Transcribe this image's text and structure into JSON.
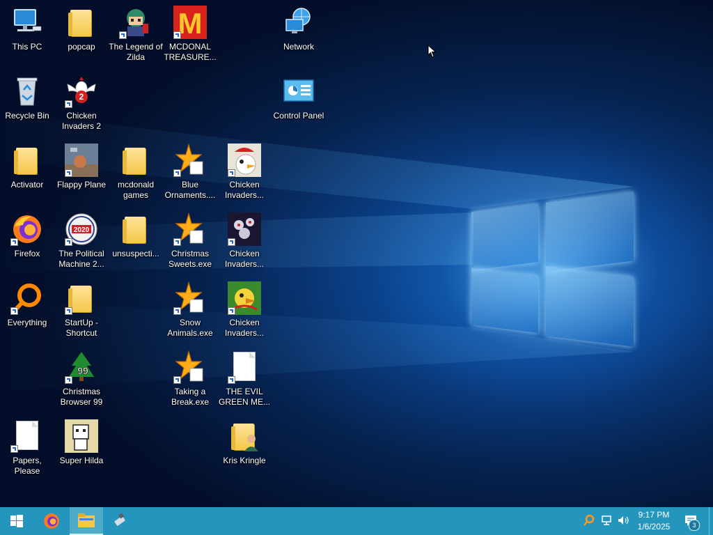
{
  "desktop": {
    "icons": {
      "this_pc": "This PC",
      "popcap": "popcap",
      "legend_of_zilda": "The Legend of Zilda",
      "mcdonal_treasure": "MCDONAL TREASURE...",
      "network": "Network",
      "recycle_bin": "Recycle Bin",
      "chicken_invaders_2": "Chicken Invaders 2",
      "control_panel": "Control Panel",
      "activator": "Activator",
      "flappy_plane": "Flappy Plane",
      "mcdonald_games": "mcdonald games",
      "blue_ornaments": "Blue Ornaments....",
      "chicken_invaders_a": "Chicken Invaders...",
      "firefox": "Firefox",
      "political_machine": "The Political Machine 2...",
      "unsuspecti": "unsuspecti...",
      "christmas_sweets": "Christmas Sweets.exe",
      "chicken_invaders_b": "Chicken Invaders...",
      "everything": "Everything",
      "startup_shortcut": "StartUp - Shortcut",
      "snow_animals": "Snow Animals.exe",
      "chicken_invaders_c": "Chicken Invaders...",
      "christmas_browser": "Christmas Browser 99",
      "taking_a_break": "Taking a Break.exe",
      "evil_green": "THE EVIL GREEN ME...",
      "papers_please": "Papers, Please",
      "super_hilda": "Super Hilda",
      "kris_kringle": "Kris Kringle"
    },
    "badges": {
      "political_year": "2020",
      "browser_number": "99",
      "chicken_number": "2"
    },
    "logo_text": {
      "mcdonalds": "M"
    }
  },
  "taskbar": {
    "clock_time": "9:17 PM",
    "clock_date": "1/6/2025",
    "notification_count": "3"
  },
  "colors": {
    "taskbar": "#2496bd",
    "folder": "#f3c84a",
    "wallpaper_glow": "#6cc3ff"
  }
}
